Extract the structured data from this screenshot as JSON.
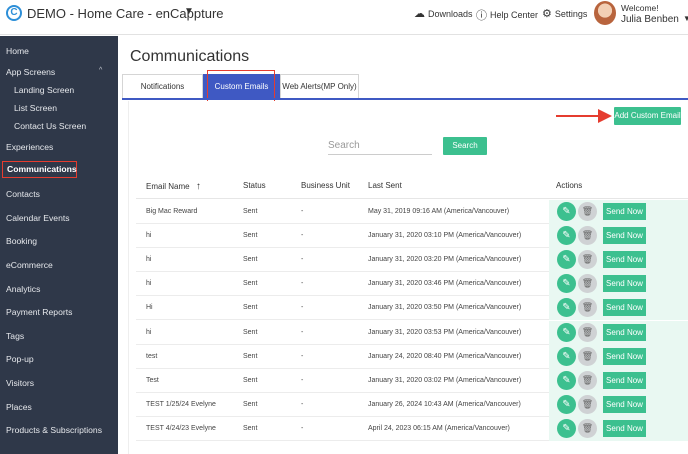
{
  "header": {
    "logo_letter": "C",
    "app_title": "DEMO - Home Care - enCappture",
    "downloads": "Downloads",
    "help_center": "Help Center",
    "settings": "Settings",
    "welcome": "Welcome!",
    "user_name": "Julia Benben"
  },
  "sidebar": {
    "items": [
      {
        "label": "Home"
      },
      {
        "label": "App Screens"
      },
      {
        "label": "Landing Screen"
      },
      {
        "label": "List Screen"
      },
      {
        "label": "Contact Us Screen"
      },
      {
        "label": "Experiences"
      },
      {
        "label": "Communications"
      },
      {
        "label": "Contacts"
      },
      {
        "label": "Calendar Events"
      },
      {
        "label": "Booking"
      },
      {
        "label": "eCommerce"
      },
      {
        "label": "Analytics"
      },
      {
        "label": "Payment Reports"
      },
      {
        "label": "Tags"
      },
      {
        "label": "Pop-up"
      },
      {
        "label": "Visitors"
      },
      {
        "label": "Places"
      },
      {
        "label": "Products & Subscriptions"
      }
    ],
    "active": "Communications"
  },
  "page": {
    "title": "Communications",
    "tabs": [
      {
        "label": "Notifications"
      },
      {
        "label": "Custom Emails"
      },
      {
        "label": "Web Alerts(MP Only)"
      }
    ],
    "active_tab": "Custom Emails",
    "add_button": "Add Custom Email",
    "search_placeholder": "Search",
    "search_button": "Search"
  },
  "table": {
    "columns": [
      "Email Name",
      "Status",
      "Business Unit",
      "Last Sent",
      "Actions"
    ],
    "sort_column": "Email Name",
    "send_label": "Send Now",
    "rows": [
      {
        "name": "Big Mac Reward",
        "status": "Sent",
        "unit": "-",
        "last_sent": "May 31, 2019 09:16 AM (America/Vancouver)"
      },
      {
        "name": "hi",
        "status": "Sent",
        "unit": "-",
        "last_sent": "January 31, 2020 03:10 PM (America/Vancouver)"
      },
      {
        "name": "hi",
        "status": "Sent",
        "unit": "-",
        "last_sent": "January 31, 2020 03:20 PM (America/Vancouver)"
      },
      {
        "name": "hi",
        "status": "Sent",
        "unit": "-",
        "last_sent": "January 31, 2020 03:46 PM (America/Vancouver)"
      },
      {
        "name": "Hi",
        "status": "Sent",
        "unit": "-",
        "last_sent": "January 31, 2020 03:50 PM (America/Vancouver)"
      },
      {
        "name": "hi",
        "status": "Sent",
        "unit": "-",
        "last_sent": "January 31, 2020 03:53 PM (America/Vancouver)"
      },
      {
        "name": "test",
        "status": "Sent",
        "unit": "-",
        "last_sent": "January 24, 2020 08:40 PM (America/Vancouver)"
      },
      {
        "name": "Test",
        "status": "Sent",
        "unit": "-",
        "last_sent": "January 31, 2020 03:02 PM (America/Vancouver)"
      },
      {
        "name": "TEST 1/25/24 Evelyne",
        "status": "Sent",
        "unit": "-",
        "last_sent": "January 26, 2024 10:43 AM (America/Vancouver)"
      },
      {
        "name": "TEST 4/24/23 Evelyne",
        "status": "Sent",
        "unit": "-",
        "last_sent": "April 24, 2023 06:15 AM (America/Vancouver)"
      }
    ]
  },
  "colors": {
    "sidebar_bg": "#2f3849",
    "accent_blue": "#3f59c3",
    "accent_green": "#3cc08f",
    "highlight_red": "#e53c2f"
  }
}
